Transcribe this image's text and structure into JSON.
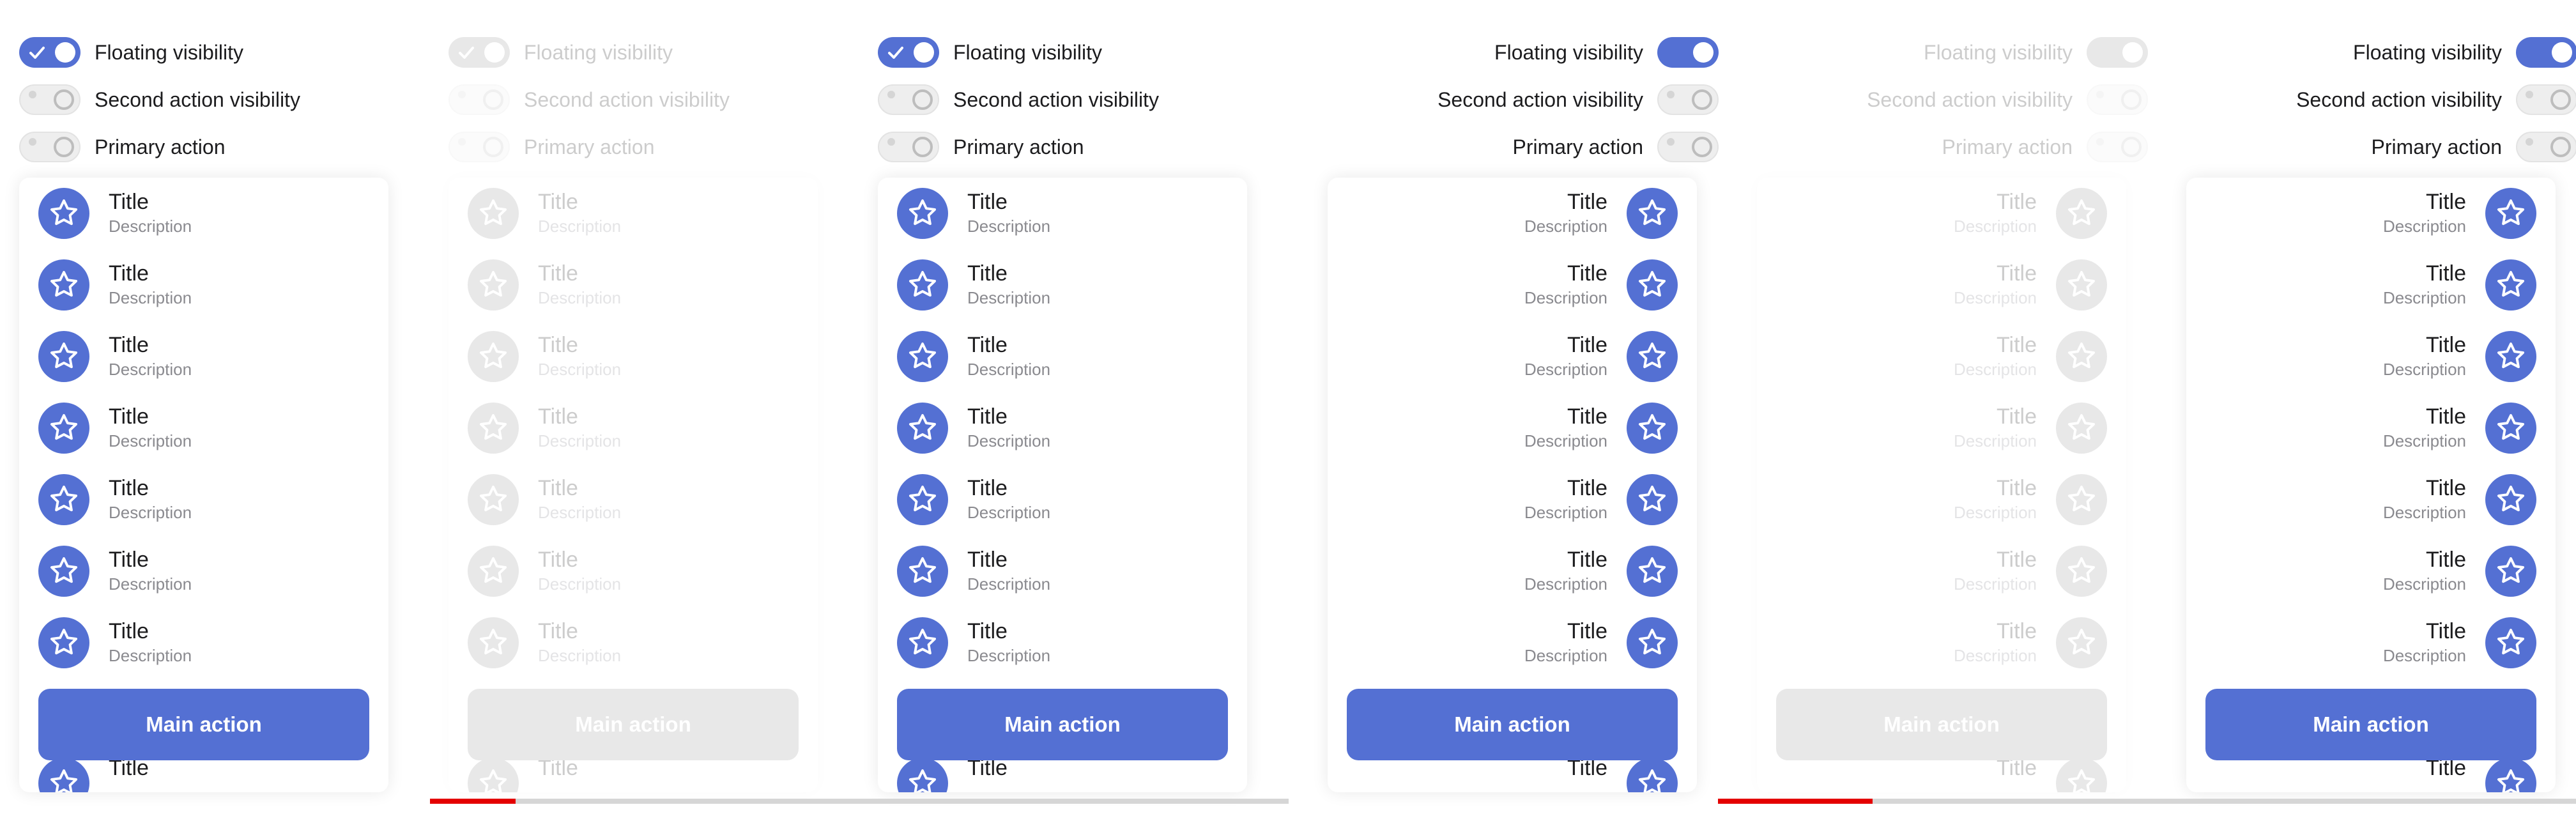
{
  "toggles": {
    "floating_visibility": "Floating visibility",
    "second_action_visibility": "Second action visibility",
    "primary_action": "Primary action"
  },
  "list": {
    "item_title": "Title",
    "item_description": "Description",
    "item_icon": "star-icon"
  },
  "main_action_label": "Main action",
  "variants": [
    {
      "direction": "ltr",
      "state": "enabled",
      "floating_visibility": true,
      "second_action_visibility": false,
      "primary_action": false
    },
    {
      "direction": "ltr",
      "state": "disabled",
      "floating_visibility": true,
      "second_action_visibility": false,
      "primary_action": false
    },
    {
      "direction": "ltr",
      "state": "enabled",
      "floating_visibility": true,
      "second_action_visibility": false,
      "primary_action": false
    },
    {
      "direction": "rtl",
      "state": "enabled",
      "floating_visibility": true,
      "second_action_visibility": false,
      "primary_action": false
    },
    {
      "direction": "rtl",
      "state": "disabled",
      "floating_visibility": true,
      "second_action_visibility": false,
      "primary_action": false
    },
    {
      "direction": "rtl",
      "state": "enabled",
      "floating_visibility": true,
      "second_action_visibility": false,
      "primary_action": false
    }
  ],
  "colors": {
    "accent": "#5470d3",
    "scroll_indicator": "#e40000",
    "scroll_track": "#d6d6d6",
    "switch_off": "#eeeeee"
  },
  "scroll_progress": [
    0.1,
    0.18
  ]
}
